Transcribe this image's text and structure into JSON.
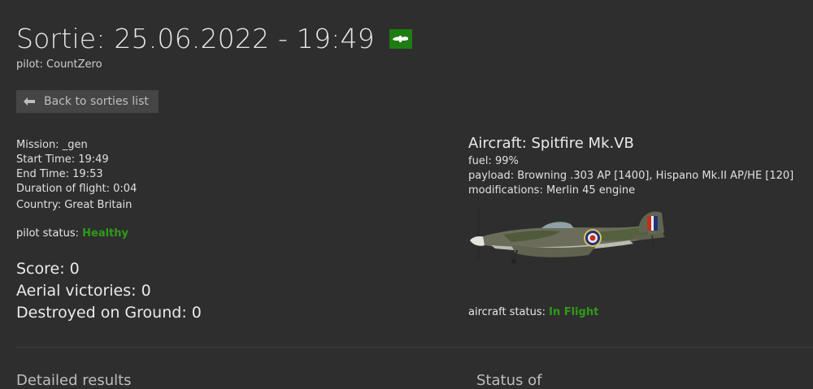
{
  "header": {
    "title": "Sortie: 25.06.2022 - 19:49",
    "pilot_line": "pilot: CountZero",
    "back_label": "Back to sorties list",
    "flag_color": "#1e7d12"
  },
  "details": {
    "mission": "Mission: _gen",
    "start_time": "Start Time: 19:49",
    "end_time": "End Time: 19:53",
    "duration": "Duration of flight: 0:04",
    "country": "Country: Great Britain"
  },
  "pilot_status": {
    "label": "pilot status:",
    "value": "Healthy"
  },
  "scores": {
    "score": "Score: 0",
    "aerial": "Aerial victories: 0",
    "ground": "Destroyed on Ground: 0"
  },
  "aircraft": {
    "title": "Aircraft: Spitfire Mk.VB",
    "fuel": "fuel: 99%",
    "payload": "payload: Browning .303 AP [1400], Hispano Mk.II AP/HE [120]",
    "modifications": "modifications: Merlin 45 engine",
    "status_label": "aircraft status:",
    "status_value": "In Flight",
    "image_icon": "spitfire-image"
  },
  "sections": {
    "left": "Detailed results",
    "right": "Status of"
  },
  "colors": {
    "status_ok": "#2f9a18",
    "background": "#2e2e2e"
  }
}
